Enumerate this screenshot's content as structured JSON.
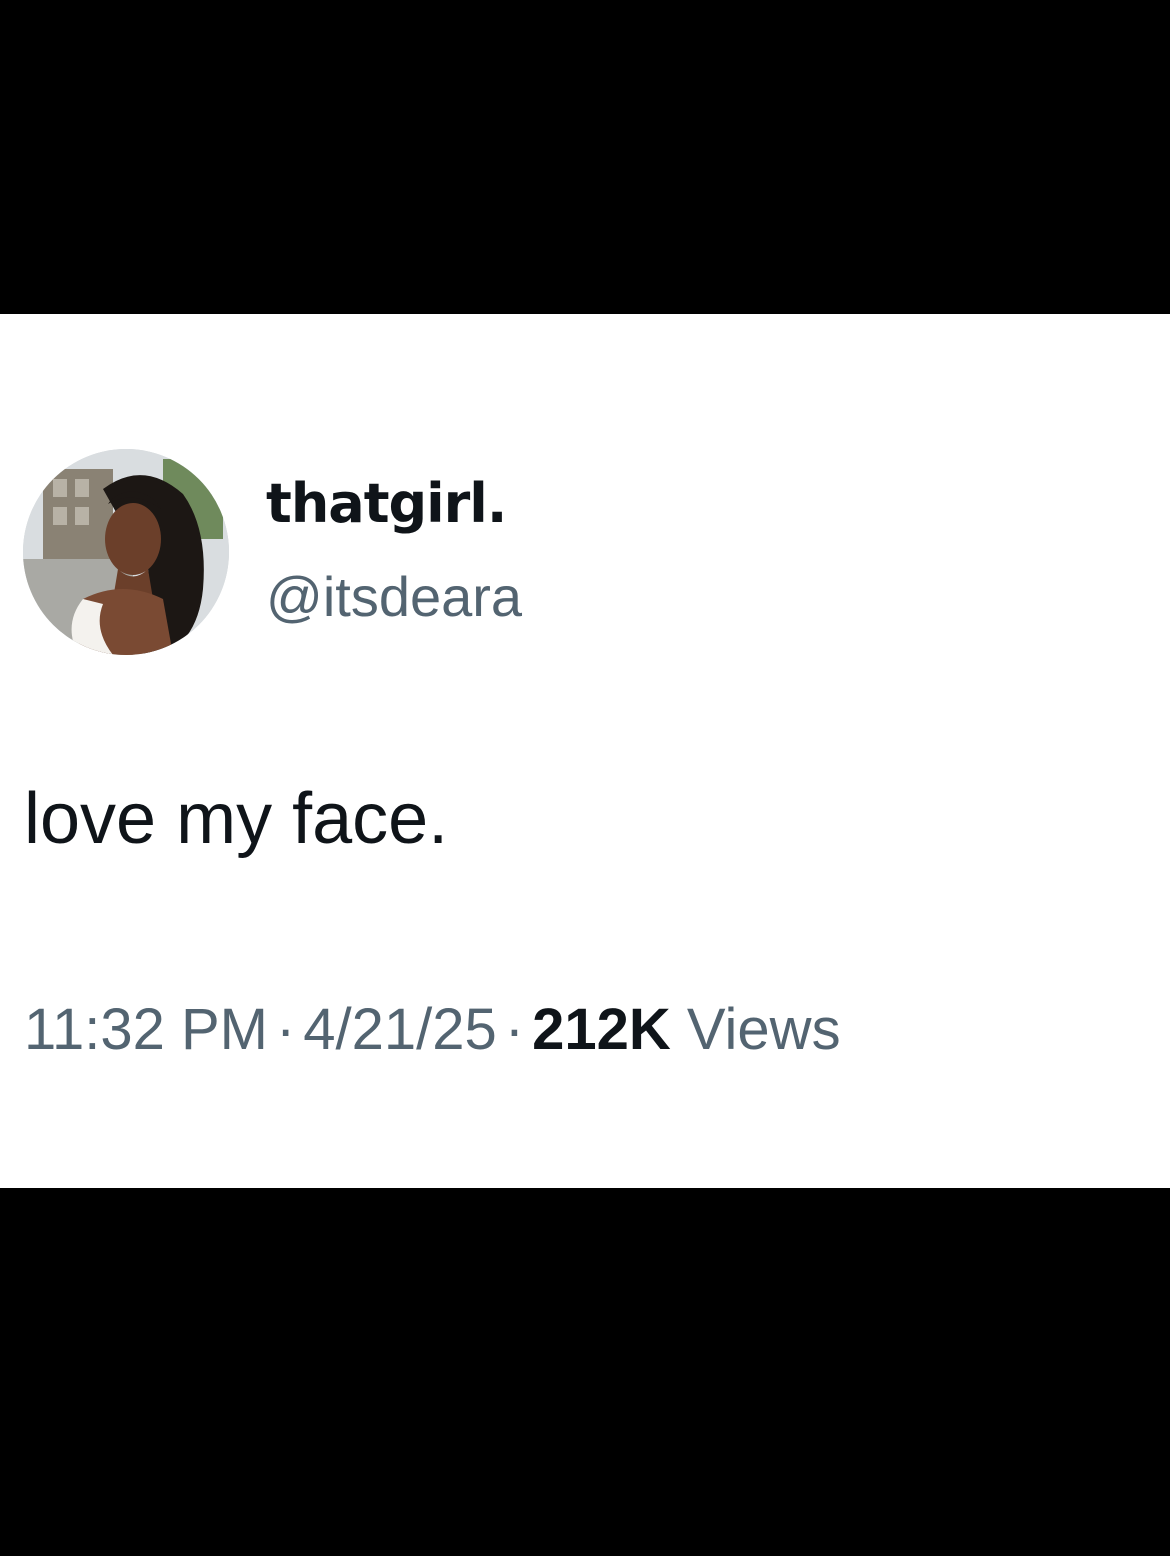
{
  "tweet": {
    "author": {
      "display_name": "thatgirl.",
      "handle": "@itsdeara"
    },
    "text": "love my face.",
    "meta": {
      "time": "11:32 PM",
      "separator": "·",
      "date": "4/21/25",
      "views_count": "212K",
      "views_label": "Views"
    }
  },
  "colors": {
    "background": "#000000",
    "card": "#ffffff",
    "primary_text": "#0f1419",
    "secondary_text": "#536471"
  }
}
